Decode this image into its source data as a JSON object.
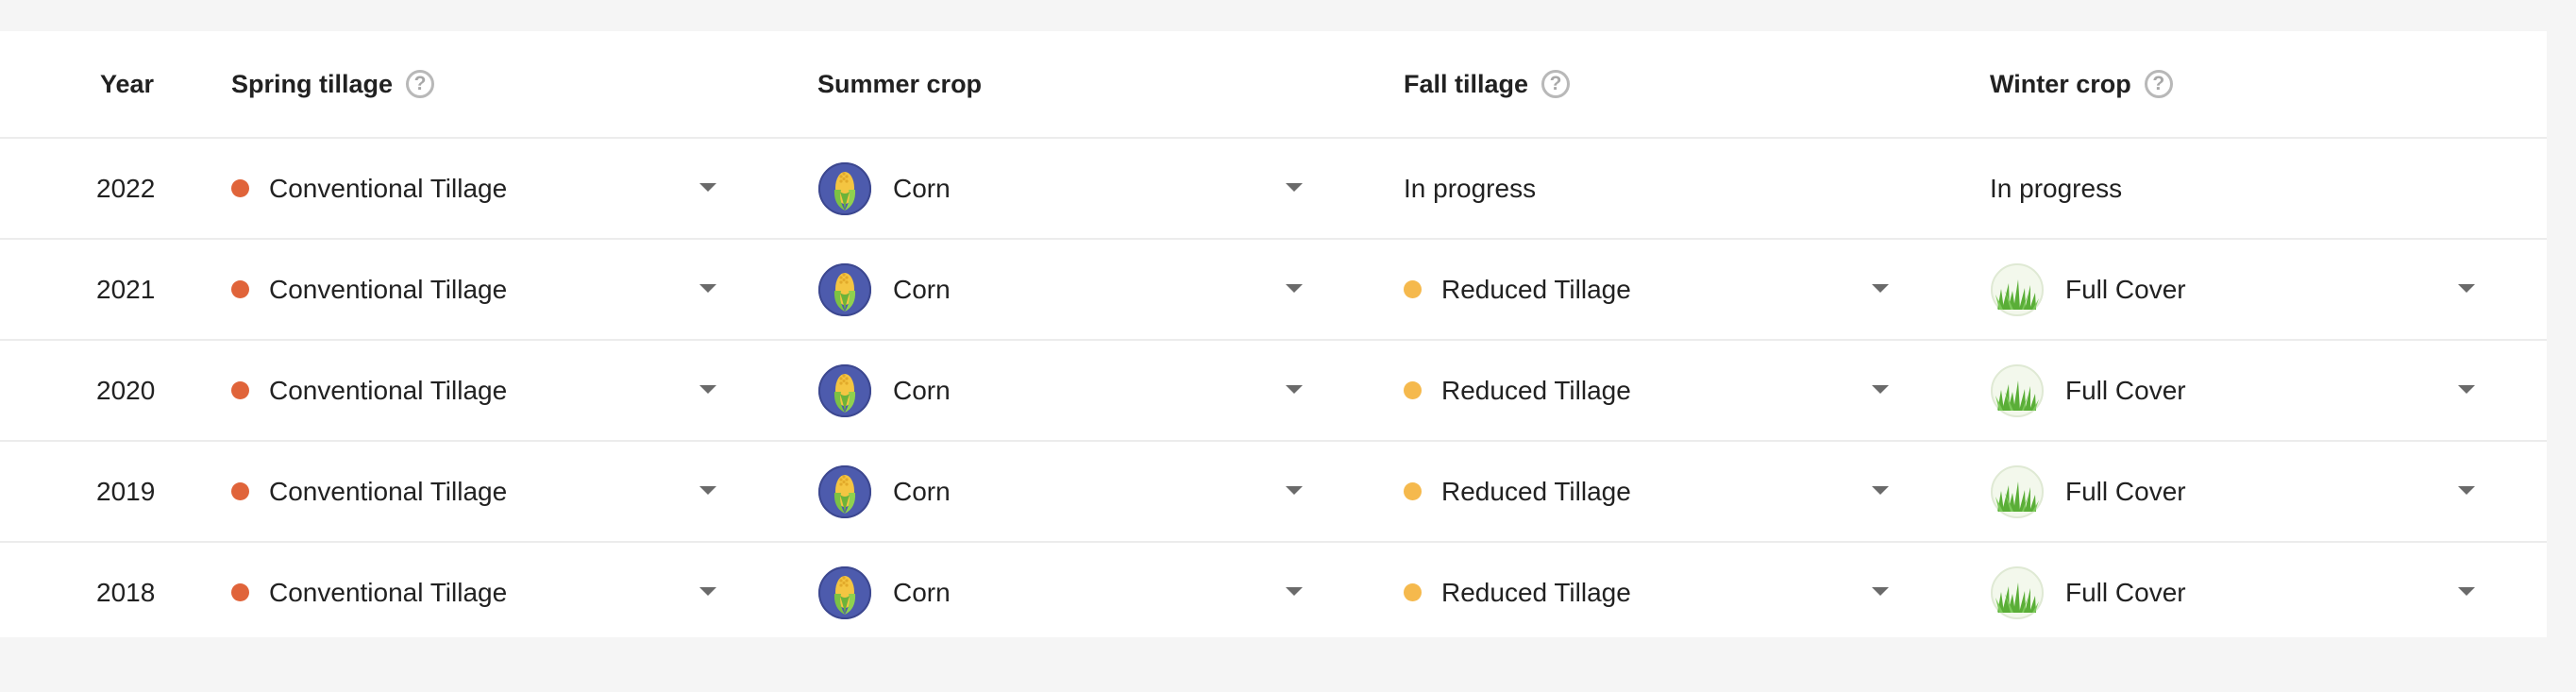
{
  "columns": {
    "year": "Year",
    "spring_tillage": "Spring tillage",
    "summer_crop": "Summer crop",
    "fall_tillage": "Fall tillage",
    "winter_crop": "Winter crop",
    "help_glyph": "?"
  },
  "colors": {
    "conventional_tillage_dot": "#e0643a",
    "reduced_tillage_dot": "#f5b94d",
    "corn_avatar_bg": "#4d5bad",
    "full_cover_avatar_bg": "#f3f8ec"
  },
  "icons": {
    "help": "help-circle-icon",
    "dropdown": "chevron-down-icon",
    "corn": "corn-icon",
    "cover_crop": "grass-icon"
  },
  "rows": [
    {
      "year": "2022",
      "spring_tillage": "Conventional Tillage",
      "summer_crop": "Corn",
      "fall_tillage": "In progress",
      "winter_crop": "In progress"
    },
    {
      "year": "2021",
      "spring_tillage": "Conventional Tillage",
      "summer_crop": "Corn",
      "fall_tillage": "Reduced Tillage",
      "winter_crop": "Full Cover"
    },
    {
      "year": "2020",
      "spring_tillage": "Conventional Tillage",
      "summer_crop": "Corn",
      "fall_tillage": "Reduced Tillage",
      "winter_crop": "Full Cover"
    },
    {
      "year": "2019",
      "spring_tillage": "Conventional Tillage",
      "summer_crop": "Corn",
      "fall_tillage": "Reduced Tillage",
      "winter_crop": "Full Cover"
    },
    {
      "year": "2018",
      "spring_tillage": "Conventional Tillage",
      "summer_crop": "Corn",
      "fall_tillage": "Reduced Tillage",
      "winter_crop": "Full Cover"
    }
  ]
}
